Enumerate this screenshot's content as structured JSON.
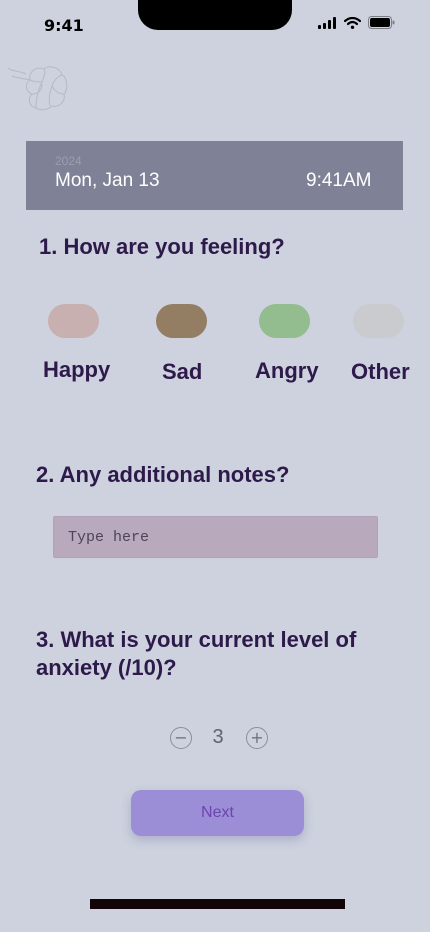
{
  "status_bar": {
    "time": "9:41",
    "icons": [
      "cellular-signal-icon",
      "wifi-icon",
      "battery-icon"
    ]
  },
  "logo": {
    "icon": "brain-logo-icon"
  },
  "date_banner": {
    "year": "2024",
    "date": "Mon, Jan 13",
    "time": "9:41AM"
  },
  "question1": {
    "title": "1. How are you feeling?",
    "moods": [
      {
        "label": "Happy",
        "color": "#c8b0b0"
      },
      {
        "label": "Sad",
        "color": "#937d63"
      },
      {
        "label": "Angry",
        "color": "#93bc8f"
      },
      {
        "label": "Other",
        "color": "#c9cbcf"
      }
    ]
  },
  "question2": {
    "title": "2. Any additional notes?",
    "placeholder": "Type here"
  },
  "question3": {
    "title": "3. What is your current level of anxiety (/10)?",
    "value": "3",
    "minus": "−",
    "plus": "+"
  },
  "next_label": "Next",
  "colors": {
    "background": "#cdd2de",
    "banner": "#7f8296",
    "heading": "#2e1a4a",
    "next_button": "#9b8ed6"
  }
}
